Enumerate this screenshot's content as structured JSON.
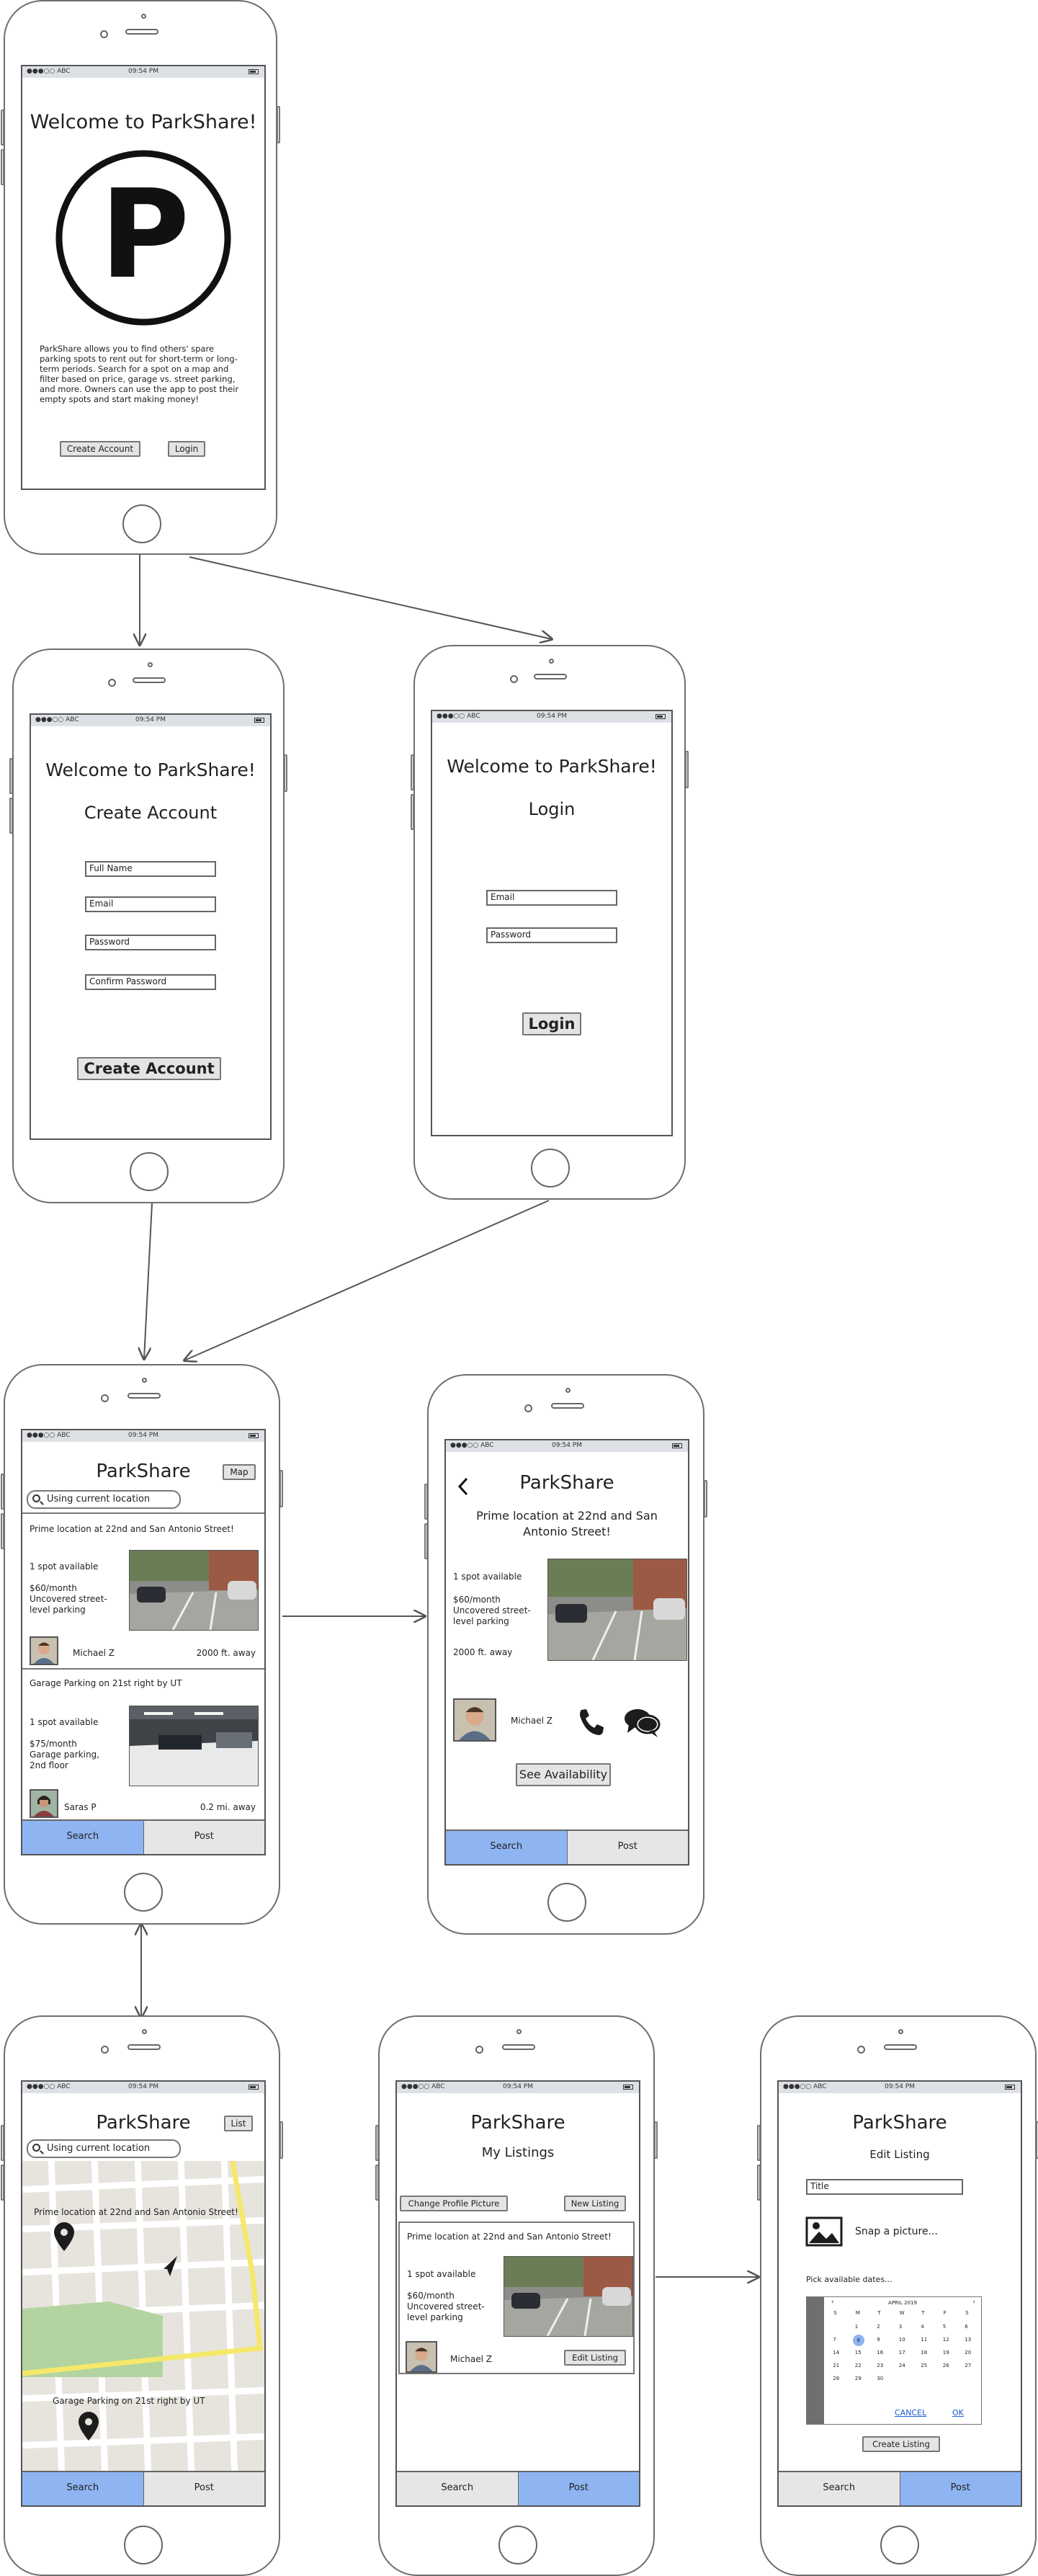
{
  "status_bar": {
    "carrier": "●●●○○ ABC",
    "time": "09:54 PM"
  },
  "welcome": {
    "title": "Welcome to ParkShare!",
    "logo_letter": "P",
    "description": "ParkShare allows you to find others' spare parking spots to rent out for short-term or long-term periods. Search for a spot on a map and filter based on price, garage vs. street parking, and more. Owners can use the app to post their empty spots and start making money!",
    "create_button": "Create Account",
    "login_button": "Login"
  },
  "create_account": {
    "title": "Welcome to ParkShare!",
    "heading": "Create Account",
    "fields": [
      "Full Name",
      "Email",
      "Password",
      "Confirm Password"
    ],
    "submit": "Create Account"
  },
  "login": {
    "title": "Welcome to ParkShare!",
    "heading": "Login",
    "fields": [
      "Email",
      "Password"
    ],
    "submit": "Login"
  },
  "search_list": {
    "app_title": "ParkShare",
    "map_button": "Map",
    "search_placeholder": "Using current location",
    "listings": [
      {
        "title": "Prime location at 22nd and San Antonio Street!",
        "availability": "1 spot available",
        "price": "$60/month",
        "type": "Uncovered street-level parking",
        "owner": "Michael Z",
        "distance": "2000 ft. away"
      },
      {
        "title": "Garage Parking on 21st right by UT",
        "availability": "1 spot available",
        "price": "$75/month",
        "type": "Garage parking, 2nd floor",
        "owner": "Saras P",
        "distance": "0.2 mi. away"
      }
    ],
    "tabs": [
      "Search",
      "Post"
    ]
  },
  "detail": {
    "app_title": "ParkShare",
    "back_icon": "chevron-left-icon",
    "listing_title": "Prime location at 22nd and San Antonio Street!",
    "availability": "1 spot available",
    "price": "$60/month",
    "type": "Uncovered street-level parking",
    "distance": "2000 ft. away",
    "owner": "Michael Z",
    "see_availability": "See Availability",
    "tabs": [
      "Search",
      "Post"
    ]
  },
  "map_view": {
    "app_title": "ParkShare",
    "list_button": "List",
    "search_placeholder": "Using current location",
    "pins": [
      "Prime location at 22nd and San Antonio Street!",
      "Garage Parking on 21st right by UT"
    ],
    "tabs": [
      "Search",
      "Post"
    ]
  },
  "my_listings": {
    "app_title": "ParkShare",
    "heading": "My Listings",
    "change_picture": "Change Profile Picture",
    "new_listing": "New Listing",
    "listing": {
      "title": "Prime location at 22nd and San Antonio Street!",
      "availability": "1 spot available",
      "price": "$60/month",
      "type": "Uncovered street-level parking",
      "owner": "Michael Z",
      "edit": "Edit Listing"
    },
    "tabs": [
      "Search",
      "Post"
    ]
  },
  "edit_listing": {
    "app_title": "ParkShare",
    "heading": "Edit Listing",
    "title_placeholder": "Title",
    "snap": "Snap a picture...",
    "pick_dates": "Pick available dates...",
    "calendar": {
      "month": "APRIL 2019",
      "weekdays": [
        "S",
        "M",
        "T",
        "W",
        "T",
        "F",
        "S"
      ],
      "selected_day": 8,
      "days_in_month": 30,
      "start_offset": 1,
      "cancel": "CANCEL",
      "ok": "OK"
    },
    "create_listing": "Create Listing",
    "tabs": [
      "Search",
      "Post"
    ]
  },
  "colors": {
    "active_tab": "#8fb4f2",
    "outline": "#666666",
    "map_road_highlight": "#f5e86a",
    "map_park": "#b3d4a0"
  }
}
